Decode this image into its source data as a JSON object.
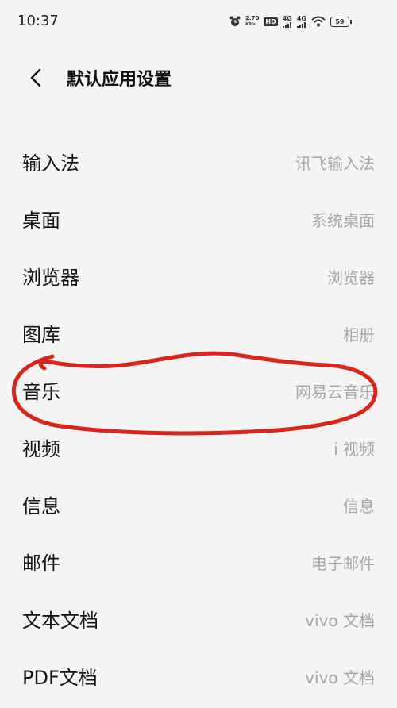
{
  "status_bar": {
    "time": "10:37",
    "speed_value": "2.70",
    "speed_unit": "KB/s",
    "hd_label": "HD",
    "sim1_label": "4G",
    "sim2_label": "4G",
    "battery": "59"
  },
  "header": {
    "title": "默认应用设置"
  },
  "settings": [
    {
      "label": "输入法",
      "value": "讯飞输入法"
    },
    {
      "label": "桌面",
      "value": "系统桌面"
    },
    {
      "label": "浏览器",
      "value": "浏览器"
    },
    {
      "label": "图库",
      "value": "相册"
    },
    {
      "label": "音乐",
      "value": "网易云音乐"
    },
    {
      "label": "视频",
      "value": "i 视频"
    },
    {
      "label": "信息",
      "value": "信息"
    },
    {
      "label": "邮件",
      "value": "电子邮件"
    },
    {
      "label": "文本文档",
      "value": "vivo 文档"
    },
    {
      "label": "PDF文档",
      "value": "vivo 文档"
    }
  ],
  "annotation": {
    "color": "#d9251c",
    "circled_item": "音乐"
  }
}
